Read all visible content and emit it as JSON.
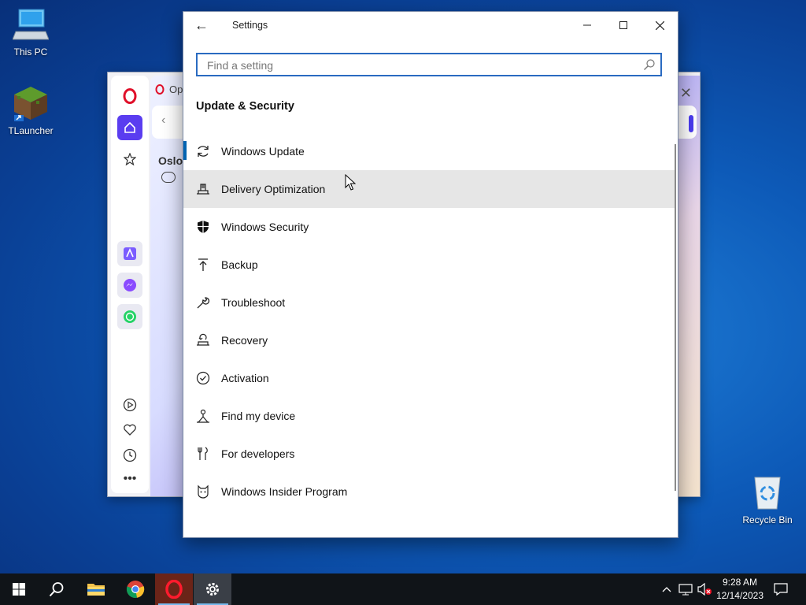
{
  "desktop": {
    "icons": [
      {
        "label": "This PC"
      },
      {
        "label": "TLauncher"
      },
      {
        "label": "Recycle Bin"
      }
    ]
  },
  "opera": {
    "tab_label": "Op",
    "city": "Oslo"
  },
  "settings": {
    "title": "Settings",
    "search": {
      "placeholder": "Find a setting",
      "value": ""
    },
    "section_title": "Update & Security",
    "nav_items": [
      {
        "label": "Windows Update",
        "icon": "sync-icon"
      },
      {
        "label": "Delivery Optimization",
        "icon": "delivery-optimization-icon"
      },
      {
        "label": "Windows Security",
        "icon": "shield-icon"
      },
      {
        "label": "Backup",
        "icon": "backup-arrow-icon"
      },
      {
        "label": "Troubleshoot",
        "icon": "wrench-icon"
      },
      {
        "label": "Recovery",
        "icon": "recovery-icon"
      },
      {
        "label": "Activation",
        "icon": "checkmark-circle-icon"
      },
      {
        "label": "Find my device",
        "icon": "find-device-icon"
      },
      {
        "label": "For developers",
        "icon": "developer-tools-icon"
      },
      {
        "label": "Windows Insider Program",
        "icon": "insider-cat-icon"
      }
    ],
    "selected_index": 0,
    "hover_index": 1
  },
  "taskbar": {
    "time": "9:28 AM",
    "date": "12/14/2023"
  },
  "colors": {
    "accent": "#0063b1",
    "search_border": "#2a6bc1",
    "taskbar": "#101418",
    "opera_red": "#e0102a",
    "opera_purple": "#5a3df0"
  }
}
